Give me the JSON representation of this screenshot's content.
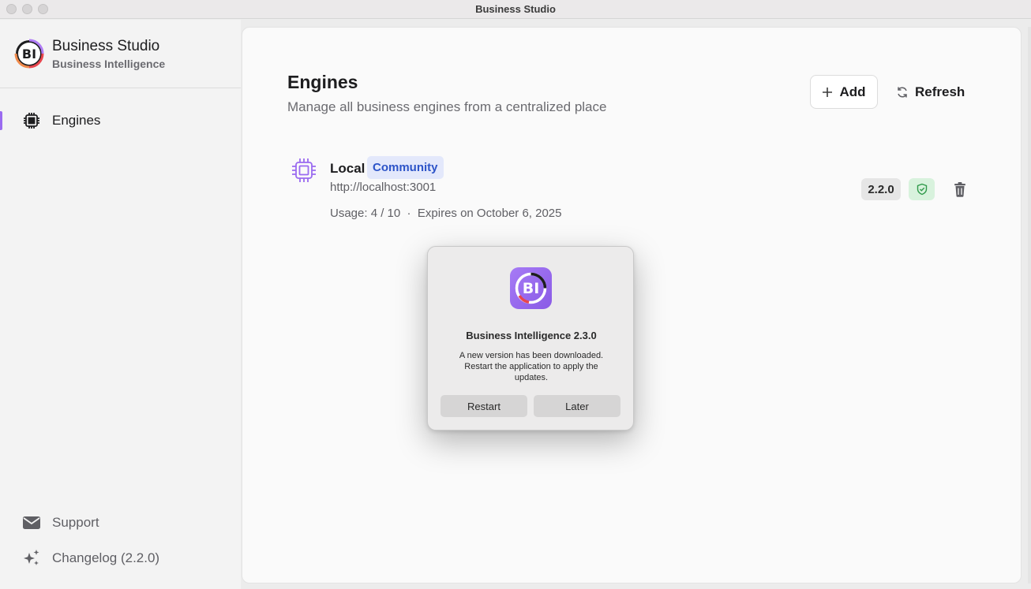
{
  "window": {
    "title": "Business Studio"
  },
  "brand": {
    "title": "Business Studio",
    "subtitle": "Business Intelligence",
    "logo_text": "BI"
  },
  "sidebar": {
    "items": [
      {
        "label": "Engines",
        "icon": "cpu-chip-icon",
        "active": true
      }
    ],
    "footer": [
      {
        "label": "Support",
        "icon": "envelope-icon"
      },
      {
        "label": "Changelog (2.2.0)",
        "icon": "sparkles-icon"
      }
    ]
  },
  "main": {
    "title": "Engines",
    "subtitle": "Manage all business engines from a centralized place",
    "actions": {
      "add_label": "Add",
      "refresh_label": "Refresh"
    },
    "engines": [
      {
        "name": "Local",
        "badge": "Community",
        "url": "http://localhost:3001",
        "meta": "Usage: 4 / 10  ·  Expires on October 6, 2025",
        "version": "2.2.0",
        "status_icon": "shield-check-icon"
      }
    ]
  },
  "dialog": {
    "title": "Business Intelligence 2.3.0",
    "message": "A new version has been downloaded. Restart the application to apply the updates.",
    "restart_label": "Restart",
    "later_label": "Later"
  },
  "colors": {
    "accent": "#9a6bf0",
    "badge_bg": "#e3e8fb",
    "badge_text": "#2d54c8",
    "success_bg": "#d8f2dd",
    "success": "#2f9a4a"
  }
}
